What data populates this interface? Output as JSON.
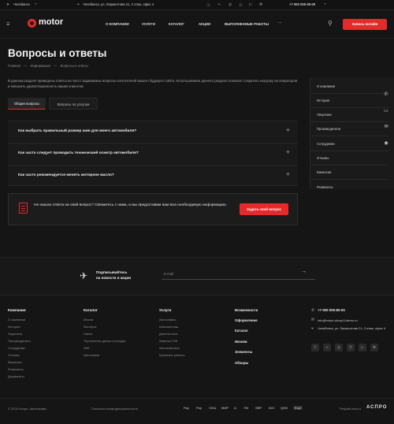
{
  "topbar": {
    "city": "Челябинск",
    "address": "Челябинск, ул. Лермонтова 21, 3 этаж, офис 4",
    "phone": "+7 000 000-00-00"
  },
  "header": {
    "logo": "motor",
    "nav": [
      "О компании",
      "Услуги",
      "Каталог",
      "Акции",
      "Выполненные работы"
    ],
    "more": "···",
    "cta": "Запись онлайн"
  },
  "page": {
    "title": "Вопросы и ответы",
    "breadcrumbs": [
      "Главная",
      "—",
      "Информация",
      "—",
      "Вопросы и ответы"
    ],
    "intro": "В данном разделе приведены ответы на часто задаваемые вопросы посетителей вашего будущего сайта. Использование данного раздела позволит сократить нагрузку на операторов и повысить удовлетворенность ваших клиентов."
  },
  "tabs": [
    "Общие вопросы",
    "Вопросы по услугам"
  ],
  "faq": [
    "Как выбрать правильный размер шин для моего автомобиля?",
    "Как часто следует проводить технический осмотр автомобиля?",
    "Как часто рекомендуется менять моторное масло?"
  ],
  "ask": {
    "text": "Не нашли ответа на свой вопрос? Свяжитесь с нами, и мы предоставим вам всю необходимую информацию.",
    "button": "Задать свой вопрос"
  },
  "sidebar": [
    "О компании",
    "История",
    "Лицензии",
    "Производители",
    "Сотрудники",
    "Отзывы",
    "Вакансии",
    "Реквизиты"
  ],
  "subscribe": {
    "text_line1": "Подписывайтесь",
    "text_line2": "на новости и акции",
    "placeholder": "E-mail"
  },
  "footer": {
    "company": {
      "title": "Компания",
      "items": [
        "О компании",
        "История",
        "Лицензии",
        "Производители",
        "Сотрудники",
        "Отзывы",
        "Вакансии",
        "Реквизиты",
        "Документы"
      ]
    },
    "catalog": {
      "title": "Каталог",
      "items": [
        "Масла",
        "Фильтры",
        "Свечи",
        "Торсионные диски и колодки",
        "АКБ",
        "Автохимия"
      ]
    },
    "services": {
      "title": "Услуги",
      "items": [
        "Автосервис",
        "Шиномонтаж",
        "Диагностика",
        "Замена ГСМ",
        "Автокомплекс",
        "Кузовные работы"
      ]
    },
    "more": [
      "Возможности",
      "Оформление",
      "Каталог",
      "Иконки",
      "Элементы",
      "Обзоры"
    ],
    "contacts": {
      "phone": "+7 000 000-00-00",
      "email": "info@motor.aicorp3-demo.ru",
      "address": "Челябинск, ул. Лермонтова 21, 3 этаж, офис 4"
    },
    "socials": [
      "vk",
      "tg",
      "ig",
      "ok",
      "yt",
      "dz"
    ],
    "copyright": "© 2024 Аспро: Автосервис",
    "privacy": "Политика конфиденциальности",
    "payments": [
      "Pay",
      "Pay",
      "VISA",
      "МИР",
      "A",
      "YM",
      "SBP",
      "ЮО",
      "QIWI",
      "Ещё"
    ],
    "developer": "Разработано в",
    "developer_brand": "АСПРО"
  }
}
